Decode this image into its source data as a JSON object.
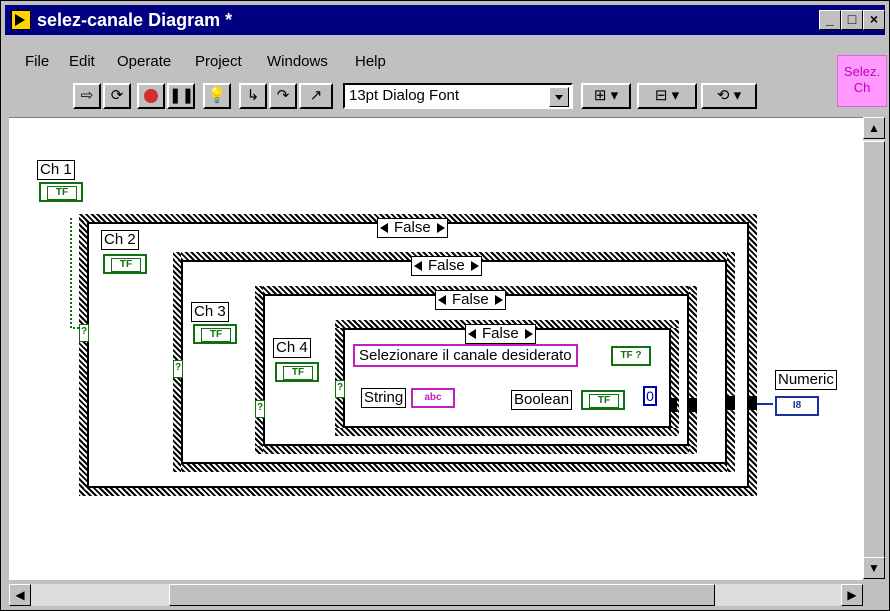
{
  "window": {
    "title": "selez-canale Diagram *",
    "min": "_",
    "max": "□",
    "close": "×"
  },
  "menu": [
    "File",
    "Edit",
    "Operate",
    "Project",
    "Windows",
    "Help"
  ],
  "toolbar": {
    "font": "13pt Dialog Font"
  },
  "palette": {
    "line1": "Selez.",
    "line2": "Ch"
  },
  "diagram": {
    "ch1": "Ch 1",
    "ch2": "Ch 2",
    "ch3": "Ch 3",
    "ch4": "Ch 4",
    "case1": "False",
    "case2": "False",
    "case3": "False",
    "case4": "False",
    "string_const": "Selezionare il canale desiderato",
    "string_label": "String",
    "abc": "abc",
    "boolean_label": "Boolean",
    "tf": "TF",
    "zero": "0",
    "numeric_label": "Numeric",
    "i8": "I8",
    "dialog_glyph": "TF ?"
  }
}
